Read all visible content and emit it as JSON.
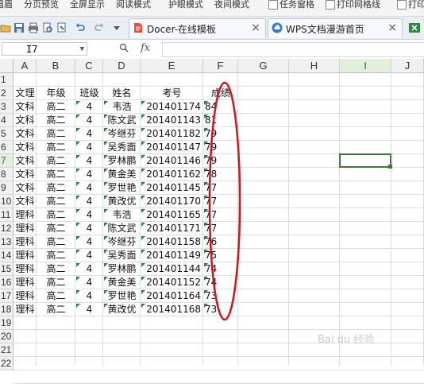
{
  "ribbon": {
    "items": [
      "眉眉",
      "分页预览",
      "全屏显示",
      "阅读模式",
      "护眼模式",
      "夜间模式",
      "任务窗格",
      "打印网格线",
      "打印"
    ]
  },
  "tabs": [
    {
      "label": "Docer-在线模板"
    },
    {
      "label": "WPS文档漫游首页"
    }
  ],
  "formula_bar": {
    "name_box": "I7",
    "fx": "fx",
    "value": ""
  },
  "columns": [
    "A",
    "B",
    "C",
    "D",
    "E",
    "F",
    "G",
    "H",
    "I",
    "J"
  ],
  "selected_column": "I",
  "selected_row": "7",
  "rows": [
    "1",
    "2",
    "3",
    "4",
    "5",
    "6",
    "7",
    "8",
    "9",
    "10",
    "11",
    "12",
    "13",
    "14",
    "15",
    "16",
    "17",
    "18",
    "19",
    "20",
    "21",
    "22"
  ],
  "headers": [
    "文理",
    "年级",
    "班级",
    "姓名",
    "考号",
    "成绩"
  ],
  "table": [
    [
      "文科",
      "高二",
      "4",
      "韦浩",
      "201401174",
      "84"
    ],
    [
      "文科",
      "高二",
      "4",
      "陈文武",
      "201401143",
      "81"
    ],
    [
      "文科",
      "高二",
      "4",
      "岑继芬",
      "201401182",
      "79"
    ],
    [
      "文科",
      "高二",
      "4",
      "吴秀面",
      "201401147",
      "79"
    ],
    [
      "文科",
      "高二",
      "4",
      "罗林鹏",
      "201401146",
      "79"
    ],
    [
      "文科",
      "高二",
      "4",
      "黄金美",
      "201401162",
      "78"
    ],
    [
      "文科",
      "高二",
      "4",
      "罗世艳",
      "201401145",
      "77"
    ],
    [
      "文科",
      "高二",
      "4",
      "黄改优",
      "201401170",
      "77"
    ],
    [
      "理科",
      "高二",
      "4",
      "韦浩",
      "201401165",
      "77"
    ],
    [
      "理科",
      "高二",
      "4",
      "陈文武",
      "201401171",
      "77"
    ],
    [
      "理科",
      "高二",
      "4",
      "岑继芬",
      "201401158",
      "76"
    ],
    [
      "理科",
      "高二",
      "4",
      "吴秀面",
      "201401149",
      "75"
    ],
    [
      "理科",
      "高二",
      "4",
      "罗林鹏",
      "201401144",
      "74"
    ],
    [
      "理科",
      "高二",
      "4",
      "黄金美",
      "201401152",
      "74"
    ],
    [
      "理科",
      "高二",
      "4",
      "罗世艳",
      "201401164",
      "73"
    ],
    [
      "理科",
      "高二",
      "4",
      "黄改优",
      "201401168",
      "73"
    ]
  ],
  "watermark": "Bai du 经验",
  "colors": {
    "annotation": "#d0141b",
    "selection": "#3e7a3c",
    "error_marker": "#1e8a3c"
  }
}
